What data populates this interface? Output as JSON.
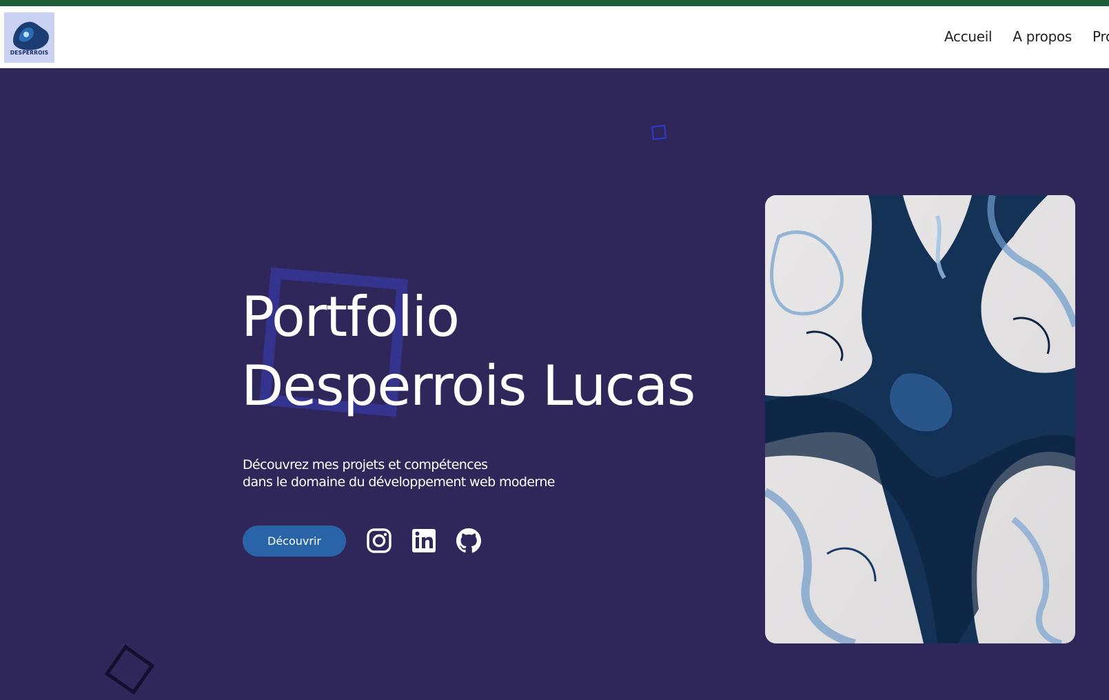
{
  "header": {
    "logo_text": "DESPERROIS",
    "nav": [
      {
        "label": "Accueil"
      },
      {
        "label": "A propos"
      },
      {
        "label": "Pro"
      }
    ]
  },
  "hero": {
    "title_lines": [
      "Portfolio",
      "Desperrois Lucas"
    ],
    "subtitle_lines": [
      "Découvrez mes projets et compétences",
      "dans le domaine du développement web moderne"
    ],
    "cta_label": "Découvrir",
    "socials": [
      {
        "icon": "instagram-icon"
      },
      {
        "icon": "linkedin-icon"
      },
      {
        "icon": "github-icon"
      }
    ],
    "image_description_icon": "abstract-marble-image"
  },
  "colors": {
    "top_strip": "#1d5d3a",
    "hero_bg": "#2f2659",
    "cta_bg": "#2a64a8",
    "logo_bg": "#c9d2f2",
    "deco_blue": "#2a3bd4"
  }
}
